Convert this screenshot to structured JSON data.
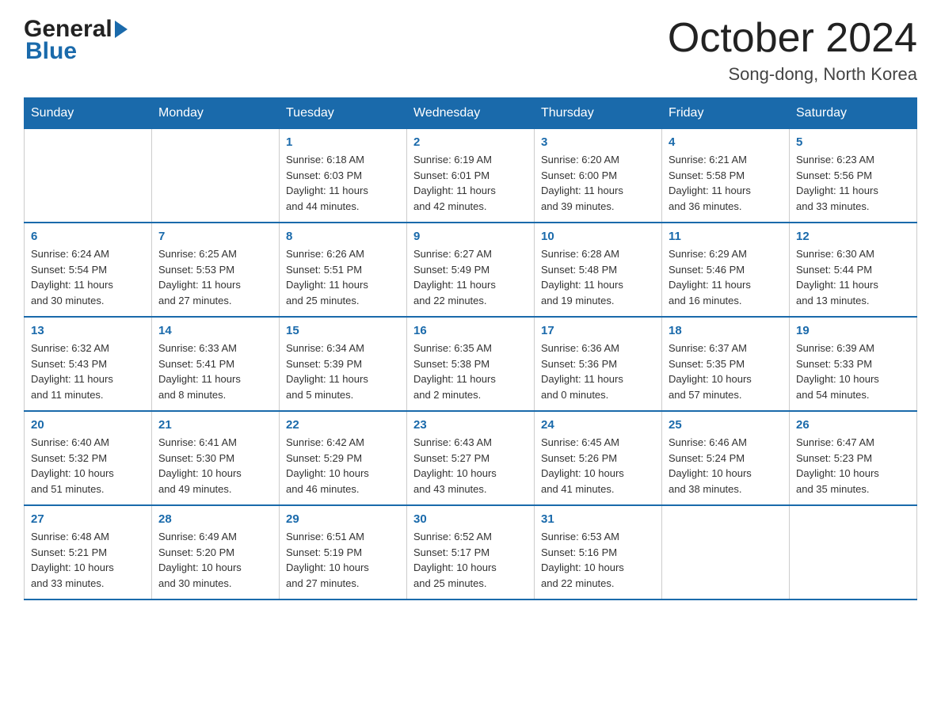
{
  "logo": {
    "general": "General",
    "blue": "Blue"
  },
  "title": "October 2024",
  "location": "Song-dong, North Korea",
  "days_of_week": [
    "Sunday",
    "Monday",
    "Tuesday",
    "Wednesday",
    "Thursday",
    "Friday",
    "Saturday"
  ],
  "weeks": [
    [
      {
        "day": "",
        "info": ""
      },
      {
        "day": "",
        "info": ""
      },
      {
        "day": "1",
        "info": "Sunrise: 6:18 AM\nSunset: 6:03 PM\nDaylight: 11 hours\nand 44 minutes."
      },
      {
        "day": "2",
        "info": "Sunrise: 6:19 AM\nSunset: 6:01 PM\nDaylight: 11 hours\nand 42 minutes."
      },
      {
        "day": "3",
        "info": "Sunrise: 6:20 AM\nSunset: 6:00 PM\nDaylight: 11 hours\nand 39 minutes."
      },
      {
        "day": "4",
        "info": "Sunrise: 6:21 AM\nSunset: 5:58 PM\nDaylight: 11 hours\nand 36 minutes."
      },
      {
        "day": "5",
        "info": "Sunrise: 6:23 AM\nSunset: 5:56 PM\nDaylight: 11 hours\nand 33 minutes."
      }
    ],
    [
      {
        "day": "6",
        "info": "Sunrise: 6:24 AM\nSunset: 5:54 PM\nDaylight: 11 hours\nand 30 minutes."
      },
      {
        "day": "7",
        "info": "Sunrise: 6:25 AM\nSunset: 5:53 PM\nDaylight: 11 hours\nand 27 minutes."
      },
      {
        "day": "8",
        "info": "Sunrise: 6:26 AM\nSunset: 5:51 PM\nDaylight: 11 hours\nand 25 minutes."
      },
      {
        "day": "9",
        "info": "Sunrise: 6:27 AM\nSunset: 5:49 PM\nDaylight: 11 hours\nand 22 minutes."
      },
      {
        "day": "10",
        "info": "Sunrise: 6:28 AM\nSunset: 5:48 PM\nDaylight: 11 hours\nand 19 minutes."
      },
      {
        "day": "11",
        "info": "Sunrise: 6:29 AM\nSunset: 5:46 PM\nDaylight: 11 hours\nand 16 minutes."
      },
      {
        "day": "12",
        "info": "Sunrise: 6:30 AM\nSunset: 5:44 PM\nDaylight: 11 hours\nand 13 minutes."
      }
    ],
    [
      {
        "day": "13",
        "info": "Sunrise: 6:32 AM\nSunset: 5:43 PM\nDaylight: 11 hours\nand 11 minutes."
      },
      {
        "day": "14",
        "info": "Sunrise: 6:33 AM\nSunset: 5:41 PM\nDaylight: 11 hours\nand 8 minutes."
      },
      {
        "day": "15",
        "info": "Sunrise: 6:34 AM\nSunset: 5:39 PM\nDaylight: 11 hours\nand 5 minutes."
      },
      {
        "day": "16",
        "info": "Sunrise: 6:35 AM\nSunset: 5:38 PM\nDaylight: 11 hours\nand 2 minutes."
      },
      {
        "day": "17",
        "info": "Sunrise: 6:36 AM\nSunset: 5:36 PM\nDaylight: 11 hours\nand 0 minutes."
      },
      {
        "day": "18",
        "info": "Sunrise: 6:37 AM\nSunset: 5:35 PM\nDaylight: 10 hours\nand 57 minutes."
      },
      {
        "day": "19",
        "info": "Sunrise: 6:39 AM\nSunset: 5:33 PM\nDaylight: 10 hours\nand 54 minutes."
      }
    ],
    [
      {
        "day": "20",
        "info": "Sunrise: 6:40 AM\nSunset: 5:32 PM\nDaylight: 10 hours\nand 51 minutes."
      },
      {
        "day": "21",
        "info": "Sunrise: 6:41 AM\nSunset: 5:30 PM\nDaylight: 10 hours\nand 49 minutes."
      },
      {
        "day": "22",
        "info": "Sunrise: 6:42 AM\nSunset: 5:29 PM\nDaylight: 10 hours\nand 46 minutes."
      },
      {
        "day": "23",
        "info": "Sunrise: 6:43 AM\nSunset: 5:27 PM\nDaylight: 10 hours\nand 43 minutes."
      },
      {
        "day": "24",
        "info": "Sunrise: 6:45 AM\nSunset: 5:26 PM\nDaylight: 10 hours\nand 41 minutes."
      },
      {
        "day": "25",
        "info": "Sunrise: 6:46 AM\nSunset: 5:24 PM\nDaylight: 10 hours\nand 38 minutes."
      },
      {
        "day": "26",
        "info": "Sunrise: 6:47 AM\nSunset: 5:23 PM\nDaylight: 10 hours\nand 35 minutes."
      }
    ],
    [
      {
        "day": "27",
        "info": "Sunrise: 6:48 AM\nSunset: 5:21 PM\nDaylight: 10 hours\nand 33 minutes."
      },
      {
        "day": "28",
        "info": "Sunrise: 6:49 AM\nSunset: 5:20 PM\nDaylight: 10 hours\nand 30 minutes."
      },
      {
        "day": "29",
        "info": "Sunrise: 6:51 AM\nSunset: 5:19 PM\nDaylight: 10 hours\nand 27 minutes."
      },
      {
        "day": "30",
        "info": "Sunrise: 6:52 AM\nSunset: 5:17 PM\nDaylight: 10 hours\nand 25 minutes."
      },
      {
        "day": "31",
        "info": "Sunrise: 6:53 AM\nSunset: 5:16 PM\nDaylight: 10 hours\nand 22 minutes."
      },
      {
        "day": "",
        "info": ""
      },
      {
        "day": "",
        "info": ""
      }
    ]
  ]
}
